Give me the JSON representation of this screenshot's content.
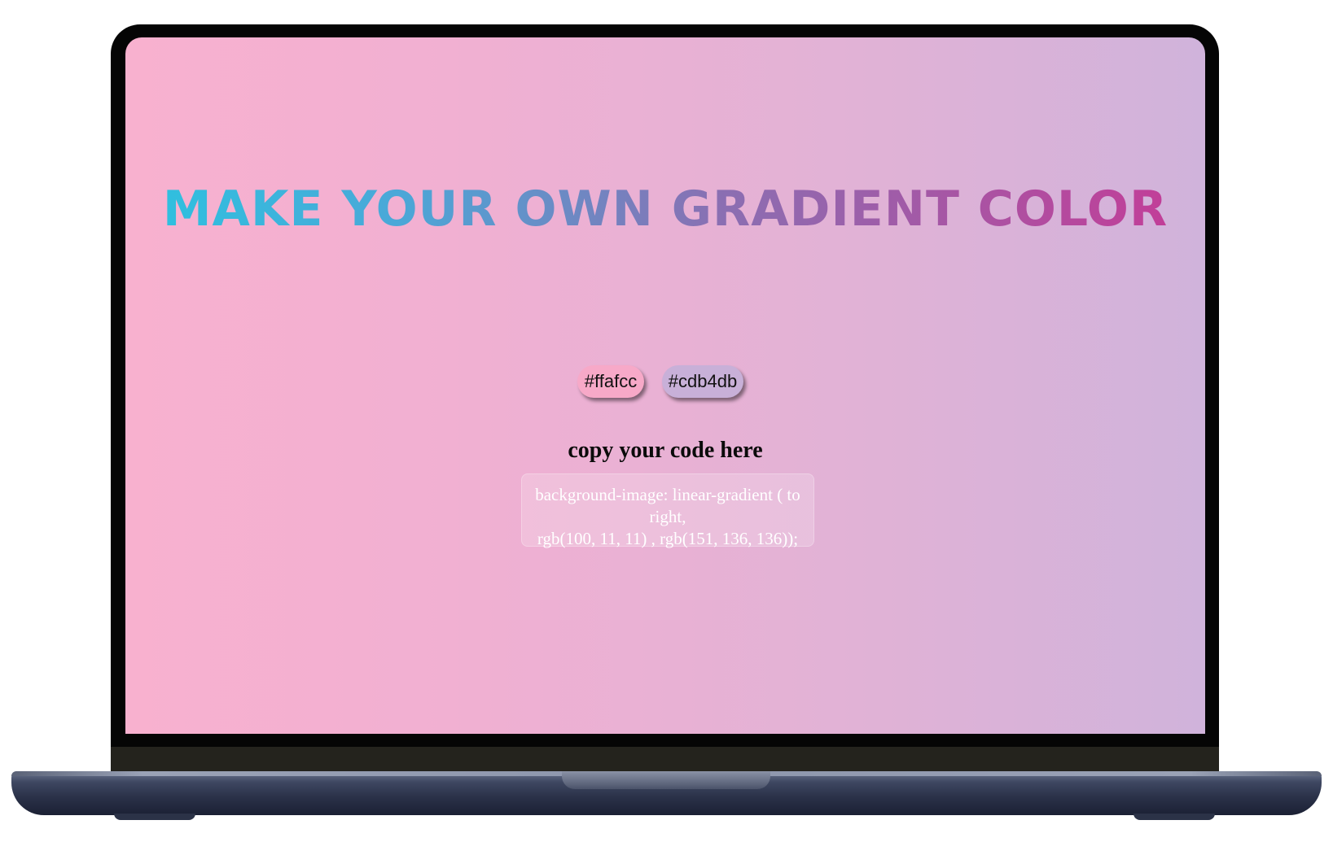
{
  "page": {
    "title": "MAKE YOUR OWN GRADIENT COLOR",
    "pickers": [
      {
        "value": "#ffafcc"
      },
      {
        "value": "#cdb4db"
      }
    ],
    "copy_heading": "copy your code here",
    "code_output": {
      "line1": "background-image: linear-gradient ( to right,",
      "line2": "rgb(100, 11, 11) , rgb(151, 136, 136));"
    }
  },
  "colors": {
    "screen_gradient_start": "#f8b1cf",
    "screen_gradient_end": "#d0b3db",
    "title_gradient_start": "#2cc3e0",
    "title_gradient_end": "#c63a96",
    "laptop_body": "#2a3148",
    "bezel": "#050505"
  }
}
